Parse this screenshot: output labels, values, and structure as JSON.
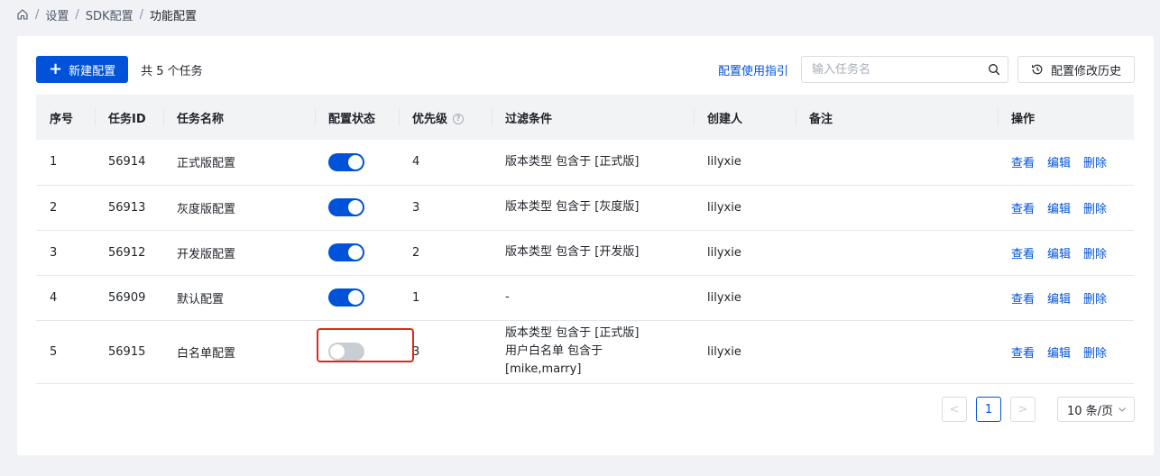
{
  "breadcrumb": {
    "items": [
      "设置",
      "SDK配置"
    ],
    "current": "功能配置",
    "separator": "/"
  },
  "toolbar": {
    "new_button": "新建配置",
    "total_text": "共 5 个任务",
    "guide_link": "配置使用指引",
    "search_placeholder": "输入任务名",
    "history_button": "配置修改历史"
  },
  "table": {
    "headers": {
      "index": "序号",
      "task_id": "任务ID",
      "task_name": "任务名称",
      "status": "配置状态",
      "priority": "优先级",
      "filter": "过滤条件",
      "creator": "创建人",
      "remark": "备注",
      "actions": "操作"
    },
    "help_icon": "?",
    "action_labels": {
      "view": "查看",
      "edit": "编辑",
      "delete": "删除"
    },
    "rows": [
      {
        "index": "1",
        "task_id": "56914",
        "task_name": "正式版配置",
        "status_on": true,
        "priority": "4",
        "filter": [
          "版本类型 包含于 [正式版]"
        ],
        "creator": "lilyxie",
        "remark": ""
      },
      {
        "index": "2",
        "task_id": "56913",
        "task_name": "灰度版配置",
        "status_on": true,
        "priority": "3",
        "filter": [
          "版本类型 包含于 [灰度版]"
        ],
        "creator": "lilyxie",
        "remark": ""
      },
      {
        "index": "3",
        "task_id": "56912",
        "task_name": "开发版配置",
        "status_on": true,
        "priority": "2",
        "filter": [
          "版本类型 包含于 [开发版]"
        ],
        "creator": "lilyxie",
        "remark": ""
      },
      {
        "index": "4",
        "task_id": "56909",
        "task_name": "默认配置",
        "status_on": true,
        "priority": "1",
        "filter": [
          "-"
        ],
        "creator": "lilyxie",
        "remark": ""
      },
      {
        "index": "5",
        "task_id": "56915",
        "task_name": "白名单配置",
        "status_on": false,
        "priority": "3",
        "filter": [
          "版本类型 包含于 [正式版]",
          "用户白名单 包含于 [mike,marry]"
        ],
        "creator": "lilyxie",
        "remark": ""
      }
    ]
  },
  "pagination": {
    "prev": "<",
    "current_page": "1",
    "next": ">",
    "page_size": "10 条/页"
  },
  "colors": {
    "primary": "#0052d9",
    "switch_off": "#c9cdd4",
    "highlight": "#e0271a"
  }
}
